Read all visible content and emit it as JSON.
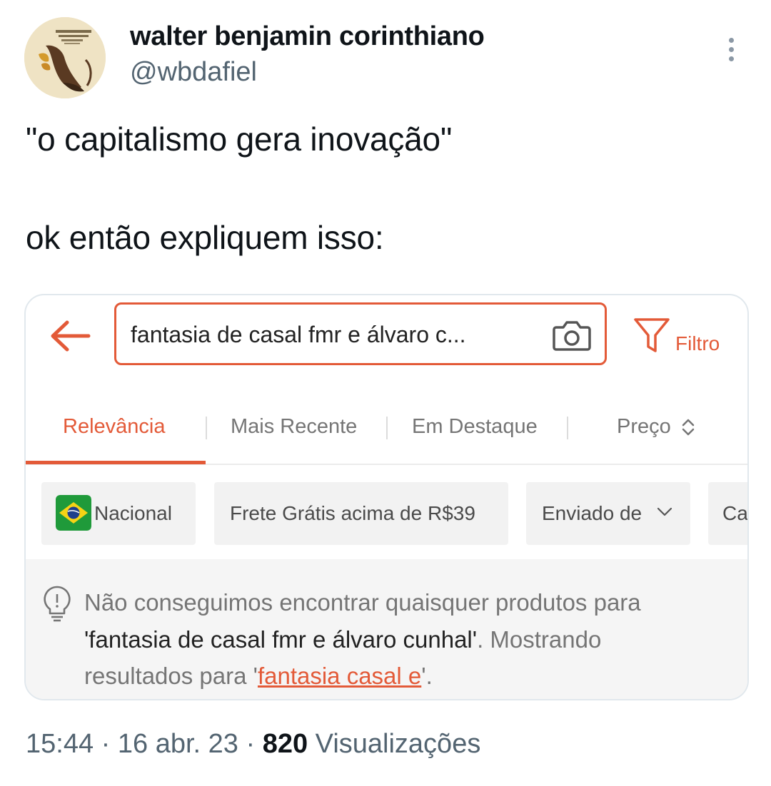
{
  "tweet": {
    "author": {
      "display_name": "walter benjamin corinthiano",
      "handle": "@wbdafiel",
      "avatar_icon": "book-cover-avatar"
    },
    "text_line1": "\"o capitalismo gera inovação\"",
    "text_line2": "ok então expliquem isso:",
    "time": "15:44",
    "separator": "·",
    "date": "16 abr. 23",
    "views_count": "820",
    "views_label": "Visualizações"
  },
  "screenshot": {
    "search": {
      "value": "fantasia de casal fmr e álvaro c...",
      "back_icon": "arrow-left-icon",
      "camera_icon": "camera-icon"
    },
    "filter_label": "Filtro",
    "tabs": [
      {
        "label": "Relevância",
        "active": true
      },
      {
        "label": "Mais Recente",
        "active": false
      },
      {
        "label": "Em Destaque",
        "active": false
      },
      {
        "label": "Preço",
        "active": false
      }
    ],
    "chips": [
      {
        "label": "Nacional",
        "icon": "brazil-flag-icon"
      },
      {
        "label": "Frete Grátis acima de R$39"
      },
      {
        "label": "Enviado de",
        "icon": "chevron-down-icon"
      },
      {
        "label": "Ca"
      }
    ],
    "notice": {
      "icon": "lightbulb-icon",
      "line1": "Não conseguimos encontrar quaisquer produtos para",
      "query_quoted": "'fantasia de casal fmr e álvaro cunhal'",
      "line2_suffix": ". Mostrando",
      "line3_prefix": "resultados para '",
      "suggestion": "fantasia casal e",
      "line3_suffix": "'."
    },
    "colors": {
      "accent": "#e35a38"
    }
  }
}
